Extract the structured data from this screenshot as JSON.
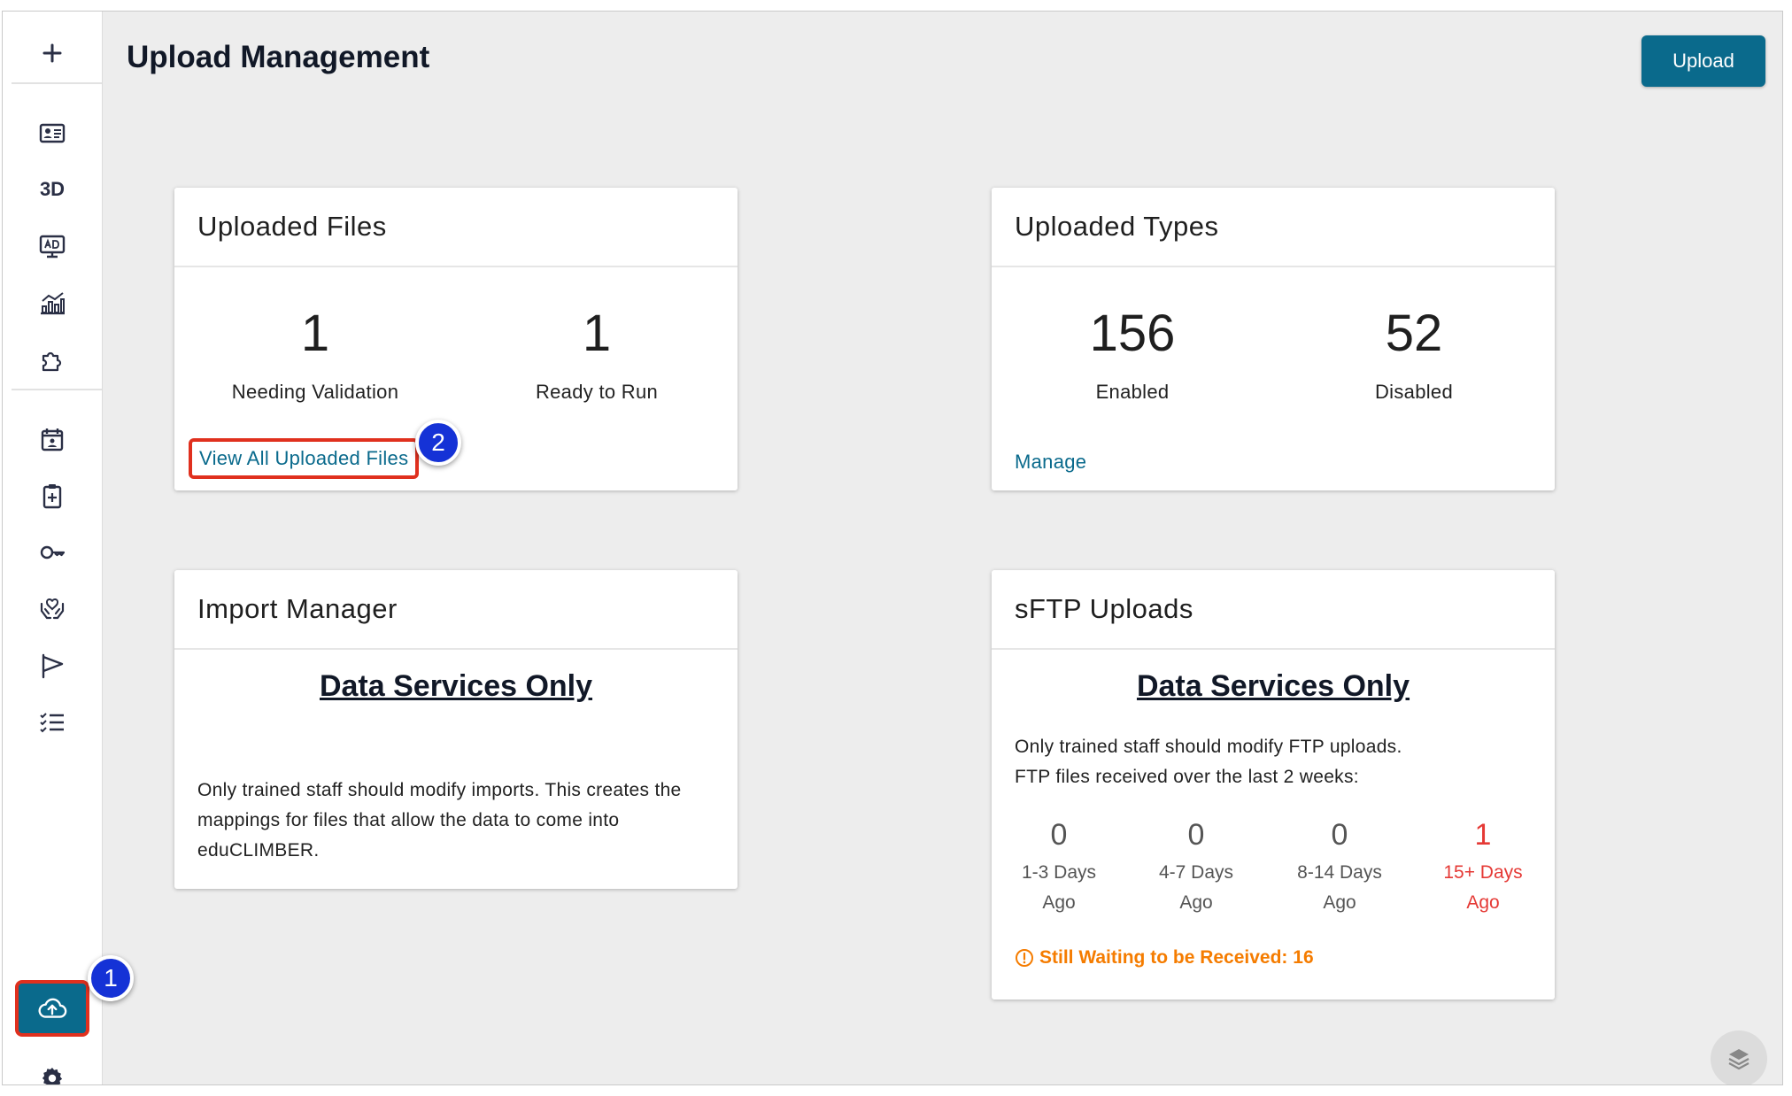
{
  "header": {
    "title": "Upload Management",
    "upload_button": "Upload"
  },
  "sidebar": {
    "nav_3d_label": "3D"
  },
  "markers": {
    "one": "1",
    "two": "2"
  },
  "uploaded_files": {
    "title": "Uploaded Files",
    "stats": [
      {
        "value": "1",
        "label": "Needing Validation"
      },
      {
        "value": "1",
        "label": "Ready to Run"
      }
    ],
    "link": "View All Uploaded Files"
  },
  "uploaded_types": {
    "title": "Uploaded Types",
    "stats": [
      {
        "value": "156",
        "label": "Enabled"
      },
      {
        "value": "52",
        "label": "Disabled"
      }
    ],
    "link": "Manage"
  },
  "import_manager": {
    "title": "Import Manager",
    "heading": "Data Services Only",
    "description": "Only trained staff should modify imports. This creates the mappings for files that allow the data to come into eduCLIMBER."
  },
  "sftp": {
    "title": "sFTP Uploads",
    "heading": "Data Services Only",
    "line1": "Only trained staff should modify FTP uploads.",
    "line2": "FTP files received over the last 2 weeks:",
    "buckets": [
      {
        "value": "0",
        "label_1": "1-3 Days",
        "label_2": "Ago"
      },
      {
        "value": "0",
        "label_1": "4-7 Days",
        "label_2": "Ago"
      },
      {
        "value": "0",
        "label_1": "8-14 Days",
        "label_2": "Ago"
      },
      {
        "value": "1",
        "label_1": "15+ Days",
        "label_2": "Ago"
      }
    ],
    "warning": "Still Waiting to be Received: 16"
  },
  "colors": {
    "primary": "#0a6a8c",
    "alert": "#e53935",
    "warning": "#f57c00",
    "marker": "#1532d6"
  }
}
